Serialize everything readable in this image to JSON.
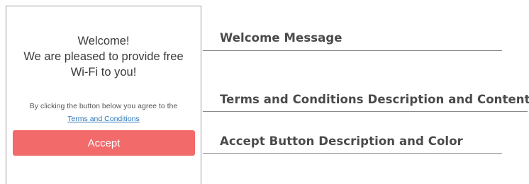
{
  "portal": {
    "welcome_lines": [
      "Welcome!",
      "We are pleased to provide free",
      "Wi-Fi to you!"
    ],
    "terms_description": "By clicking the button below you agree to the",
    "terms_link": "Terms and Conditions",
    "accept_label": "Accept"
  },
  "callouts": {
    "welcome": "Welcome Message",
    "terms": "Terms and Conditions Description and Content",
    "accept": "Accept Button Description and Color"
  },
  "colors": {
    "accept_button": "#f26a6a",
    "link": "#2d77b8",
    "callout_text": "#4a4a4a",
    "frame_border": "#9a9a9a"
  }
}
